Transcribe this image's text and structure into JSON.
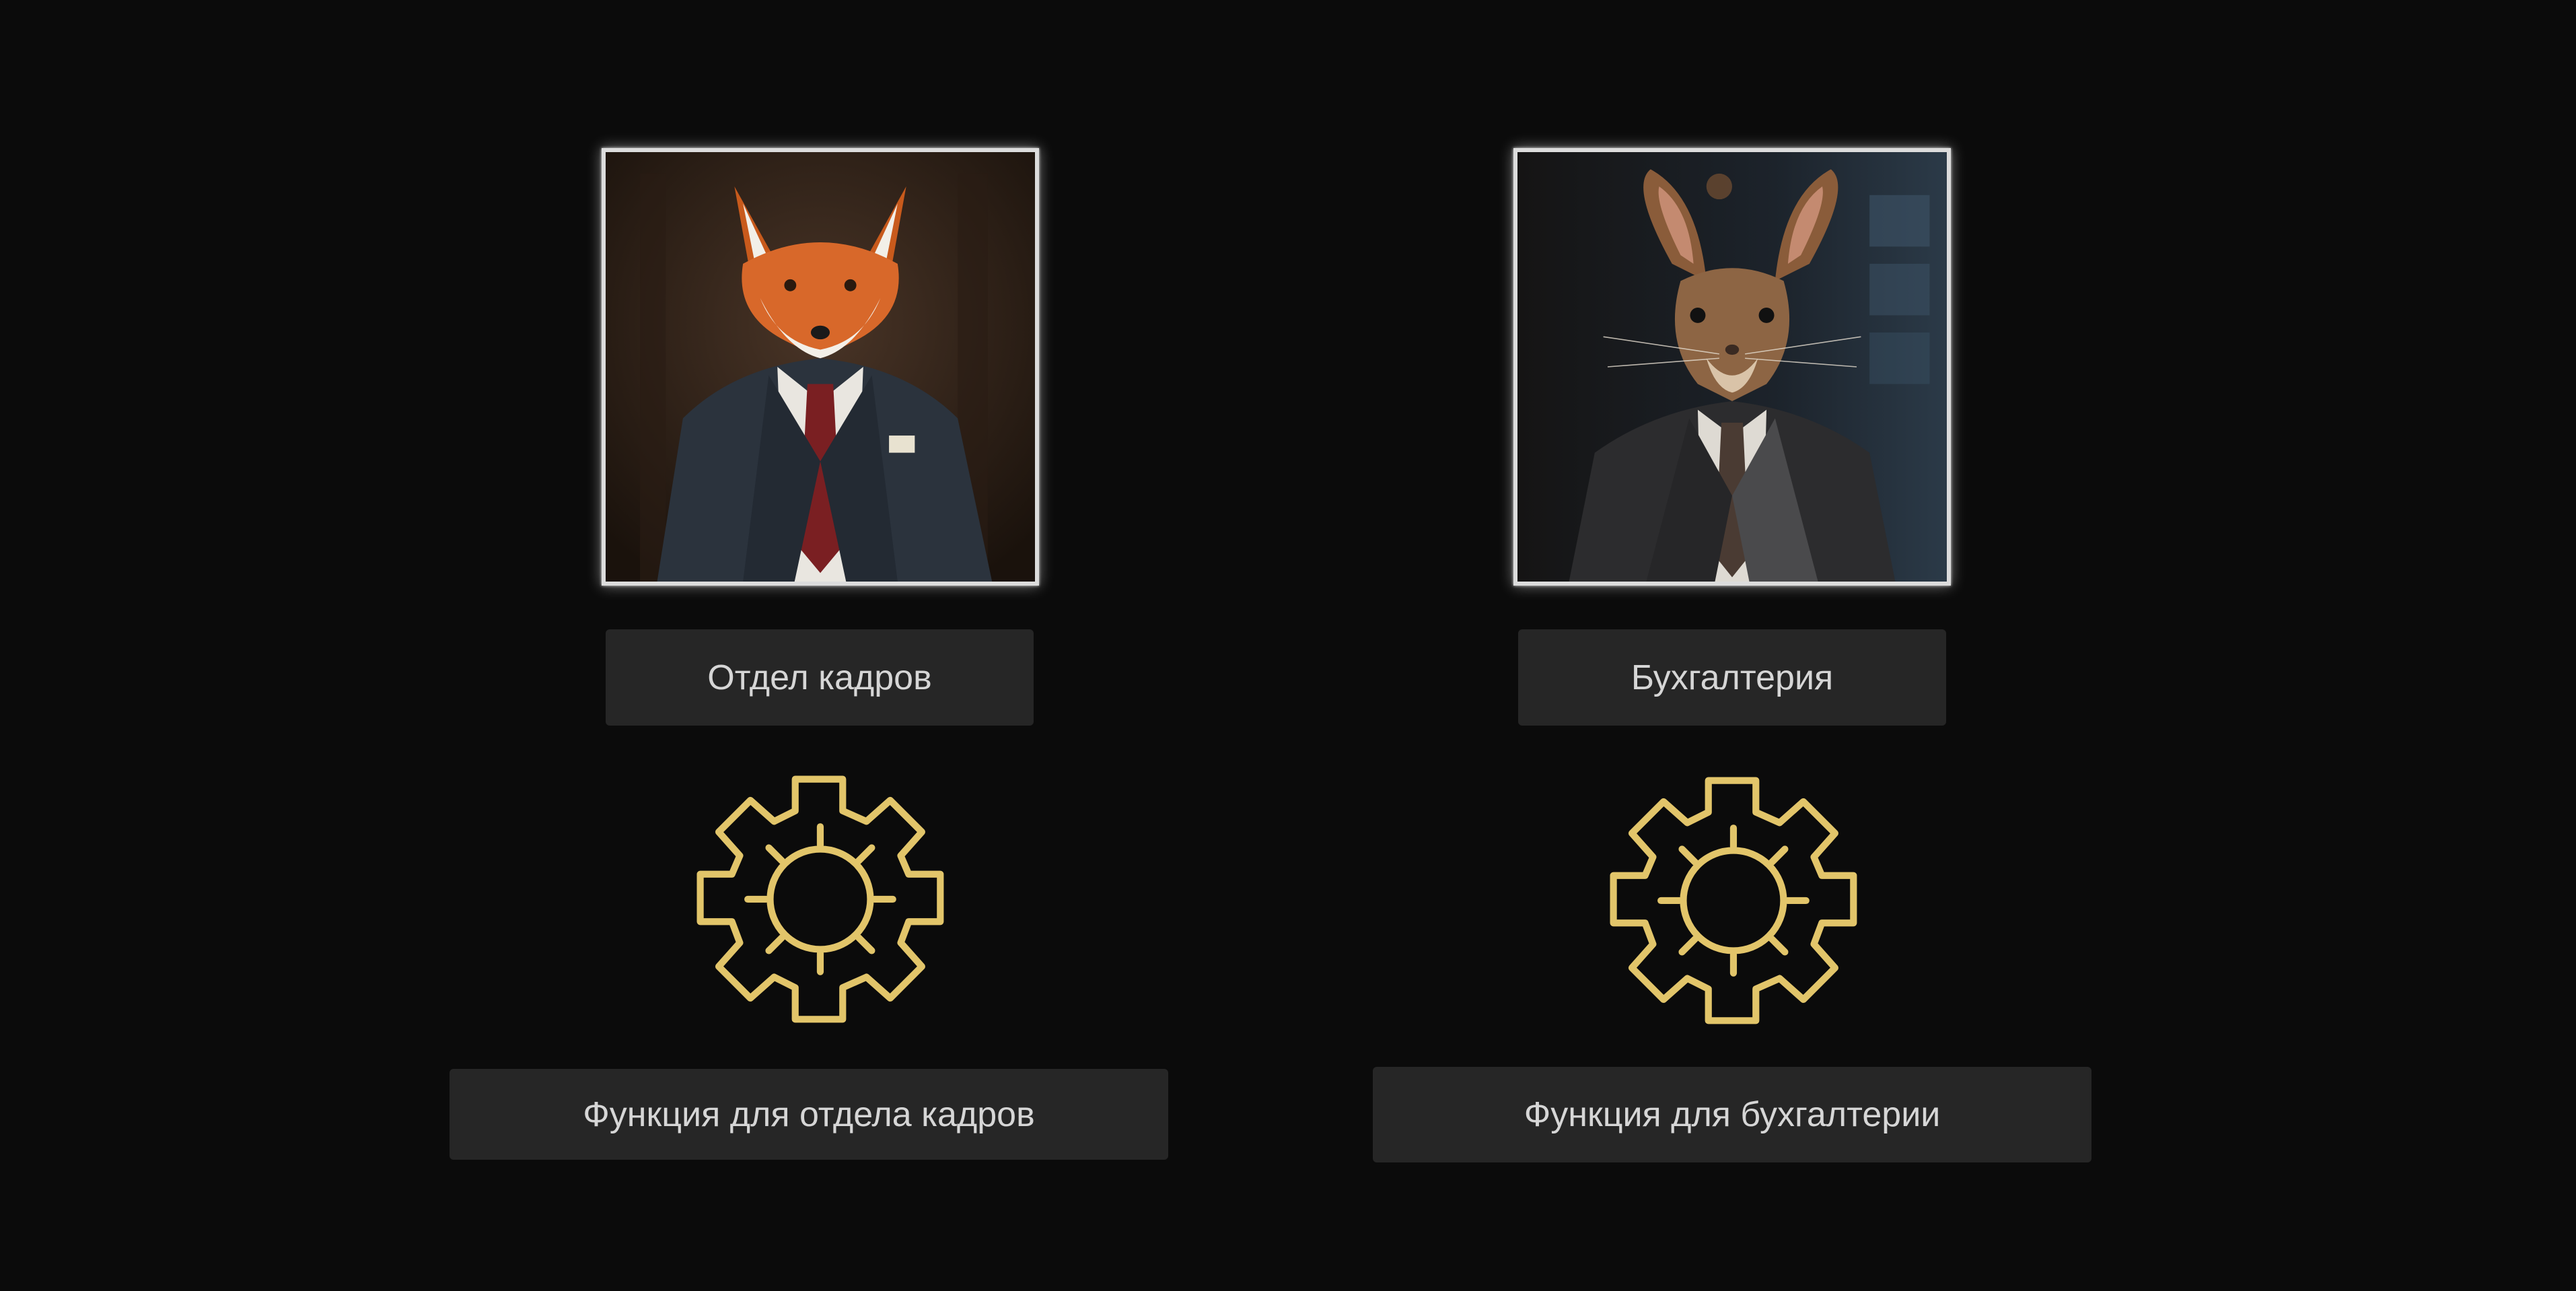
{
  "colors": {
    "background": "#0b0b0b",
    "button_bg": "#262626",
    "button_text": "#d6d6d6",
    "gear": "#e2c56a",
    "frame": "#dcdcdc"
  },
  "departments": [
    {
      "portrait_icon": "fox-in-suit-portrait",
      "title_button": "Отдел кадров",
      "settings_icon": "gear-icon",
      "function_button": "Функция для отдела кадров"
    },
    {
      "portrait_icon": "hare-in-suit-portrait",
      "title_button": "Бухгалтерия",
      "settings_icon": "gear-icon",
      "function_button": "Функция для бухгалтерии"
    }
  ]
}
